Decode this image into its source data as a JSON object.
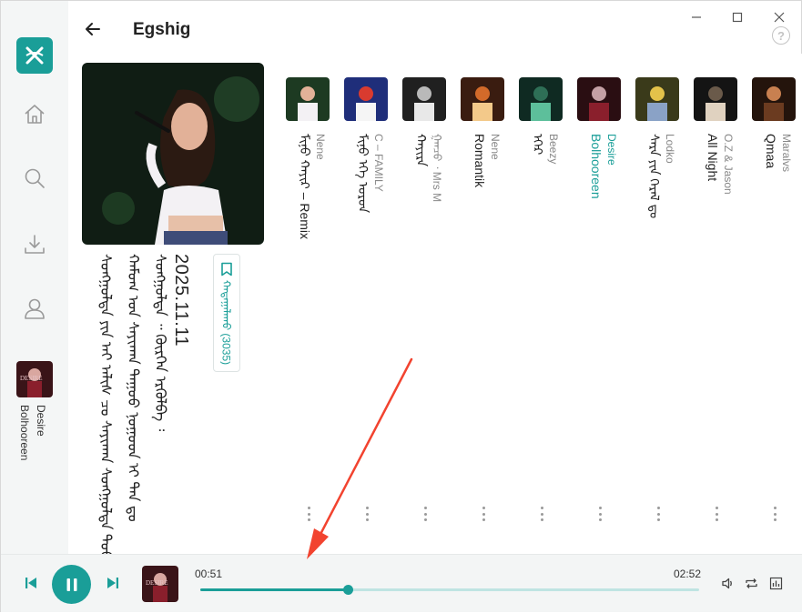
{
  "app": {
    "title": "Egshig"
  },
  "window_controls": {
    "minimize": "—",
    "maximize": "☐",
    "close": "✕",
    "help": "?"
  },
  "sidebar": {
    "items": [
      {
        "icon": "home-icon"
      },
      {
        "icon": "search-icon"
      },
      {
        "icon": "download-icon"
      },
      {
        "icon": "user-icon"
      }
    ],
    "now_playing": {
      "line1": "Desire",
      "line2": "Bolhooreen"
    }
  },
  "playlist": {
    "date": "2025.11.11",
    "desc_col1": "ᠰᠣᠩᠭᠣᠯᠲᠠ ᠶᠢᠨ ᠠᠶ ᠠᠯᠢᠰ ᠴᠤ ᠰᠠᠶᠢᠬᠠᠨ ᠰᠣᠩᠭᠣᠯᠲᠠ ᠳᠤᠤ",
    "desc_col2": "ᠬᠠᠮᠤᠭ ᠤᠨ ᠰᠠᠶᠢᠬᠠᠨ ᠳᠠᠭᠤᠤ ᠨᠤᠭᠤᠳ ᠢ ᠲᠠᠨ ᠳᠤ",
    "desc_col3": "ᠰᠣᠩᠭᠣᠯᠲᠠ ᠃ ᠬᠦᠷᠭᠡᠨ ᠡᠷᠭᠦᠯᠪᠡ ᠄",
    "count_label": "ᠬᠠᠳᠠᠭᠠᠯᠠᠬᠤ (3035)"
  },
  "tracks": [
    {
      "artist": "Nene",
      "name": "ᠮᠢᠨᠤ ᠬᠠᠶᠢᠷ – Remix",
      "active": false
    },
    {
      "artist": "C – FAMILY",
      "name": "ᠮᠢᠨᠤ ᠡᠬᠡ ᠣᠷᠣᠨ",
      "active": false
    },
    {
      "artist": "ᠭᠠᠨᠴᠤ ᠂ Mrs M",
      "name": "ᠬᠠᠶᠢᠷᠠ",
      "active": false
    },
    {
      "artist": "Nene",
      "name": "Romantik",
      "active": false
    },
    {
      "artist": "Beezy",
      "name": "ᠡᠭᠡᠷ",
      "active": false
    },
    {
      "artist": "Desire",
      "name": "Bolhooreen",
      "active": true
    },
    {
      "artist": "Lodko",
      "name": "ᠰᠠᠷᠠ ᠶᠢᠨ ᠭᠡᠷᠡᠯ ᠳᠤ",
      "active": false
    },
    {
      "artist": "O.Z & Jason",
      "name": "All Night",
      "active": false
    },
    {
      "artist": "Maralvs",
      "name": "Qmaa",
      "active": false
    }
  ],
  "player": {
    "current_time": "00:51",
    "total_time": "02:52",
    "progress": 0.296
  },
  "colors": {
    "accent": "#1a9e98",
    "annotation": "#f2432f"
  }
}
